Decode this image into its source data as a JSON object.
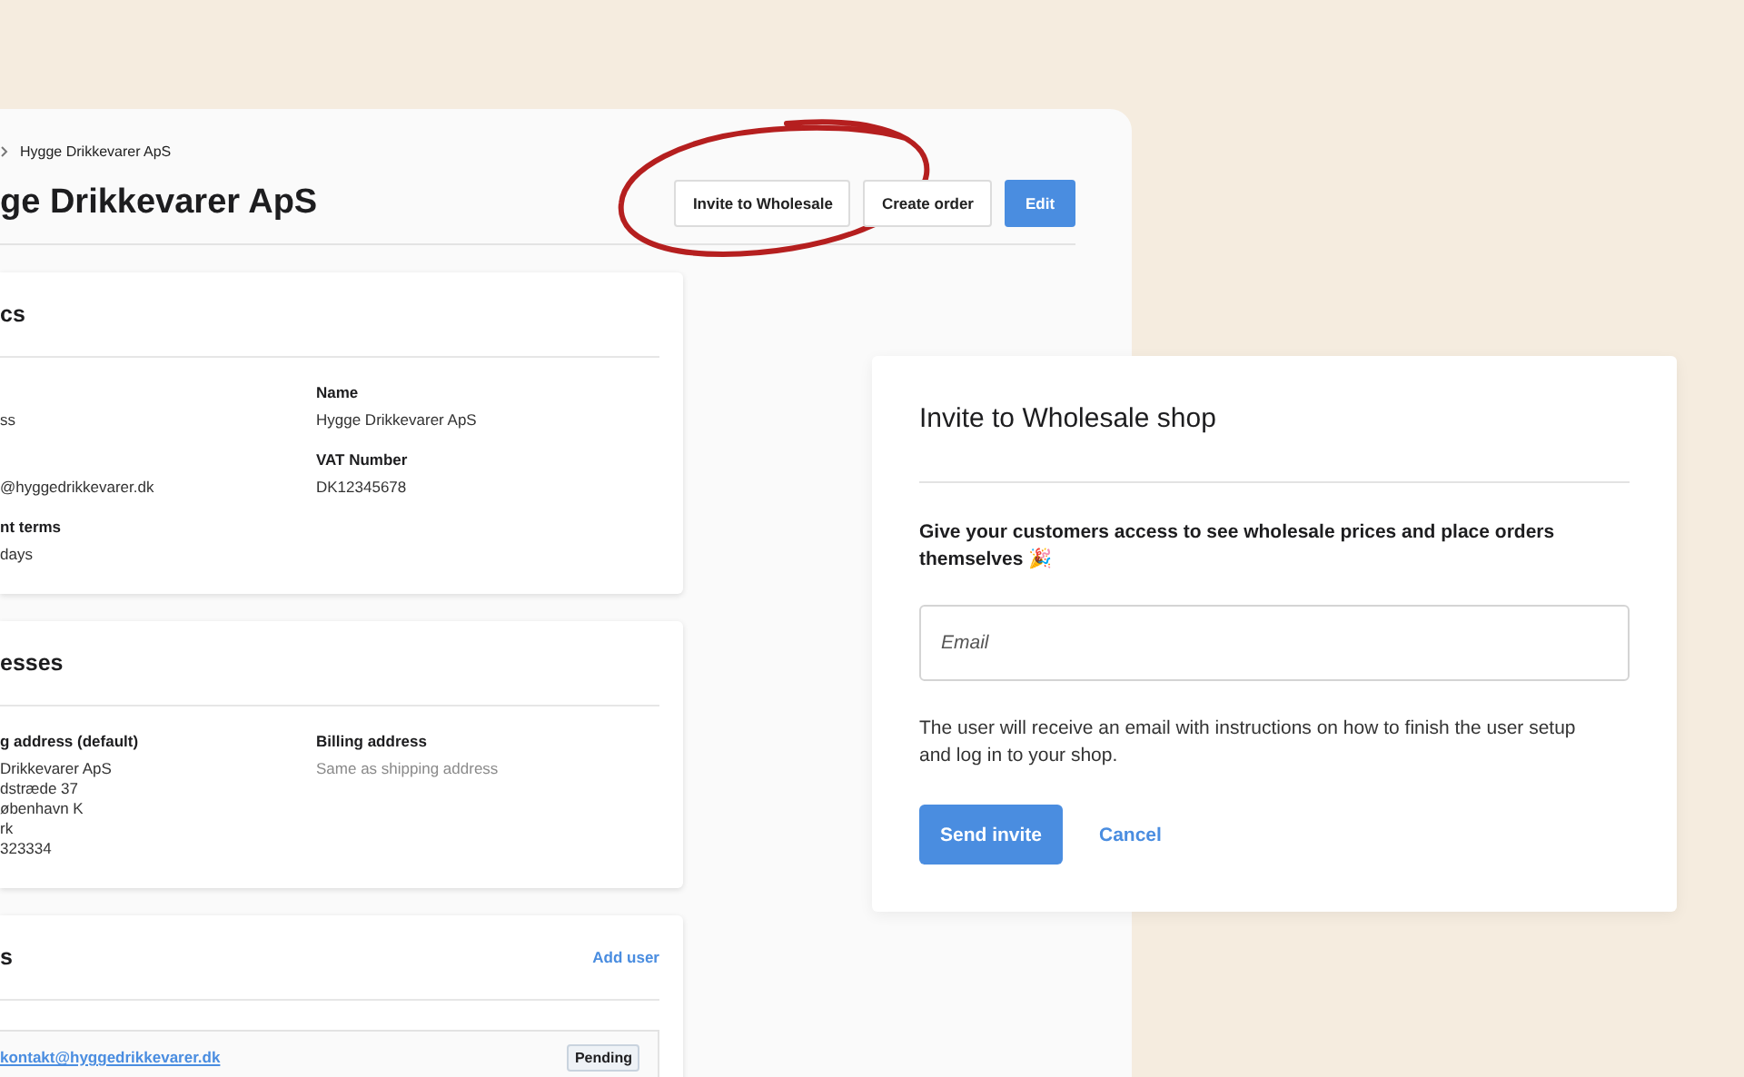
{
  "breadcrumb": {
    "current": "Hygge Drikkevarer ApS"
  },
  "page_title": "ge Drikkevarer ApS",
  "header_buttons": [
    {
      "label": "Invite to Wholesale",
      "kind": "default"
    },
    {
      "label": "Create order",
      "kind": "default"
    },
    {
      "label": "Edit",
      "kind": "primary"
    }
  ],
  "details_card": {
    "heading": "cs",
    "fields": [
      {
        "value": "ss"
      },
      {
        "label": "Name",
        "value": "Hygge Drikkevarer ApS"
      },
      {
        "value": "@hyggedrikkevarer.dk"
      },
      {
        "label": "VAT Number",
        "value": "DK12345678"
      },
      {
        "label": "nt terms",
        "value": "days"
      }
    ]
  },
  "addresses_card": {
    "heading": "esses",
    "columns": [
      {
        "label": "g address (default)",
        "lines": [
          "Drikkevarer ApS",
          "dstræde 37",
          "øbenhavn K",
          "rk",
          "323334"
        ],
        "muted": false
      },
      {
        "label": "Billing address",
        "lines": [
          "Same as shipping address"
        ],
        "muted": true
      }
    ]
  },
  "users_card": {
    "heading": "s",
    "action": "Add user",
    "users": [
      {
        "email": "kontakt@hyggedrikkevarer.dk",
        "status": "Pending"
      }
    ]
  },
  "dialog": {
    "title": "Invite to Wholesale shop",
    "lead": "Give your customers access to see wholesale prices and place orders themselves 🎉",
    "email_field": {
      "placeholder": "Email"
    },
    "note": "The user will receive an email with instructions on how to finish the user setup and log in to your shop.",
    "primary_button": "Send invite",
    "secondary_button": "Cancel"
  }
}
